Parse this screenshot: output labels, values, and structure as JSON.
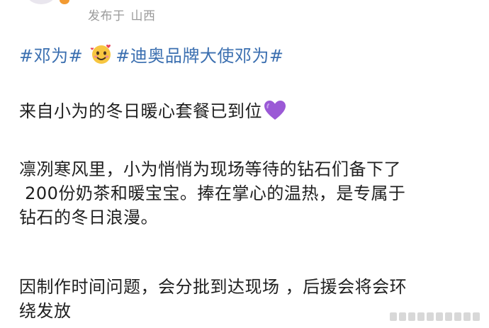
{
  "header": {
    "published_prefix": "发布于",
    "location": "山西"
  },
  "hashtags": [
    "#邓为#",
    "#迪奥品牌大使邓为#"
  ],
  "emoji_names": [
    "smiling-face-with-hearts-icon",
    "purple-heart-icon"
  ],
  "post": {
    "line1": "来自小为的冬日暖心套餐已到位",
    "paragraph2": [
      "凛冽寒风里，小为悄悄为现场等待的钻石们备下了",
      " 200份奶茶和暖宝宝。捧在掌心的温热，是专属于",
      "钻石的冬日浪漫。"
    ],
    "paragraph3": [
      "因制作时间问题，会分批到达现场 ，后援会将会环",
      "绕发放"
    ]
  },
  "colors": {
    "hashtag": "#3b6fb0",
    "text": "#1f1f1f",
    "meta": "#9a9a9a",
    "heart": "#9b59d6"
  }
}
